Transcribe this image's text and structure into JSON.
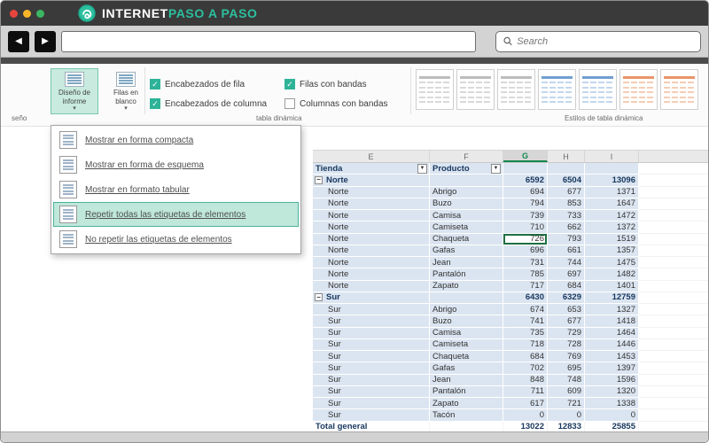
{
  "window": {
    "logo_part1": "INTERNET",
    "logo_part2": "PASO A PASO",
    "search_placeholder": "Search"
  },
  "ribbon": {
    "report_layout_button": "Diseño de informe",
    "blank_rows_button": "Filas en blanco",
    "checkboxes": [
      {
        "label": "Encabezados de fila",
        "checked": true
      },
      {
        "label": "Encabezados de columna",
        "checked": true
      },
      {
        "label": "Filas con bandas",
        "checked": true
      },
      {
        "label": "Columnas con bandas",
        "checked": false
      }
    ],
    "gallery_styles": [
      "plain",
      "plain",
      "plain",
      "blue",
      "blue",
      "orange",
      "orange"
    ],
    "group_labels": {
      "left": "seño",
      "center": "tabla dinámica",
      "right": "Estilos de tabla dinámica"
    }
  },
  "menu": {
    "items": [
      {
        "label": "Mostrar en forma compacta",
        "selected": false
      },
      {
        "label": "Mostrar en forma de esquema",
        "selected": false
      },
      {
        "label": "Mostrar en formato tabular",
        "selected": false
      },
      {
        "label": "Repetir todas las etiquetas de elementos",
        "selected": true
      },
      {
        "label": "No repetir las etiquetas de elementos",
        "selected": false
      }
    ]
  },
  "sheet": {
    "column_letters": [
      "E",
      "F",
      "G",
      "H",
      "I"
    ],
    "active_column": "G",
    "header": {
      "col1": "Tienda",
      "col2": "Producto"
    },
    "selected_cell": {
      "column": "G",
      "region": "Norte",
      "product": "Chaqueta",
      "value": 726
    },
    "rows": [
      {
        "kind": "group",
        "label": "Norte",
        "v1": 6592,
        "v2": 6504,
        "v3": 13096
      },
      {
        "kind": "detail",
        "region": "Norte",
        "product": "Abrigo",
        "v1": 694,
        "v2": 677,
        "v3": 1371
      },
      {
        "kind": "detail",
        "region": "Norte",
        "product": "Buzo",
        "v1": 794,
        "v2": 853,
        "v3": 1647
      },
      {
        "kind": "detail",
        "region": "Norte",
        "product": "Camisa",
        "v1": 739,
        "v2": 733,
        "v3": 1472
      },
      {
        "kind": "detail",
        "region": "Norte",
        "product": "Camiseta",
        "v1": 710,
        "v2": 662,
        "v3": 1372
      },
      {
        "kind": "detail",
        "region": "Norte",
        "product": "Chaqueta",
        "v1": 726,
        "v2": 793,
        "v3": 1519,
        "selected": true
      },
      {
        "kind": "detail",
        "region": "Norte",
        "product": "Gafas",
        "v1": 696,
        "v2": 661,
        "v3": 1357
      },
      {
        "kind": "detail",
        "region": "Norte",
        "product": "Jean",
        "v1": 731,
        "v2": 744,
        "v3": 1475
      },
      {
        "kind": "detail",
        "region": "Norte",
        "product": "Pantalón",
        "v1": 785,
        "v2": 697,
        "v3": 1482
      },
      {
        "kind": "detail",
        "region": "Norte",
        "product": "Zapato",
        "v1": 717,
        "v2": 684,
        "v3": 1401
      },
      {
        "kind": "group",
        "label": "Sur",
        "v1": 6430,
        "v2": 6329,
        "v3": 12759
      },
      {
        "kind": "detail",
        "region": "Sur",
        "product": "Abrigo",
        "v1": 674,
        "v2": 653,
        "v3": 1327
      },
      {
        "kind": "detail",
        "region": "Sur",
        "product": "Buzo",
        "v1": 741,
        "v2": 677,
        "v3": 1418
      },
      {
        "kind": "detail",
        "region": "Sur",
        "product": "Camisa",
        "v1": 735,
        "v2": 729,
        "v3": 1464
      },
      {
        "kind": "detail",
        "region": "Sur",
        "product": "Camiseta",
        "v1": 718,
        "v2": 728,
        "v3": 1446
      },
      {
        "kind": "detail",
        "region": "Sur",
        "product": "Chaqueta",
        "v1": 684,
        "v2": 769,
        "v3": 1453
      },
      {
        "kind": "detail",
        "region": "Sur",
        "product": "Gafas",
        "v1": 702,
        "v2": 695,
        "v3": 1397
      },
      {
        "kind": "detail",
        "region": "Sur",
        "product": "Jean",
        "v1": 848,
        "v2": 748,
        "v3": 1596
      },
      {
        "kind": "detail",
        "region": "Sur",
        "product": "Pantalón",
        "v1": 711,
        "v2": 609,
        "v3": 1320
      },
      {
        "kind": "detail",
        "region": "Sur",
        "product": "Zapato",
        "v1": 617,
        "v2": 721,
        "v3": 1338
      },
      {
        "kind": "detail",
        "region": "Sur",
        "product": "Tacón",
        "v1": 0,
        "v2": 0,
        "v3": 0
      },
      {
        "kind": "total",
        "label": "Total general",
        "v1": 13022,
        "v2": 12833,
        "v3": 25855
      }
    ]
  },
  "colors": {
    "brand_teal": "#2cbf9f",
    "menu_highlight": "#bfe7da",
    "pivot_row_blue": "#dbe5f1",
    "selection_green": "#1d6f42"
  }
}
